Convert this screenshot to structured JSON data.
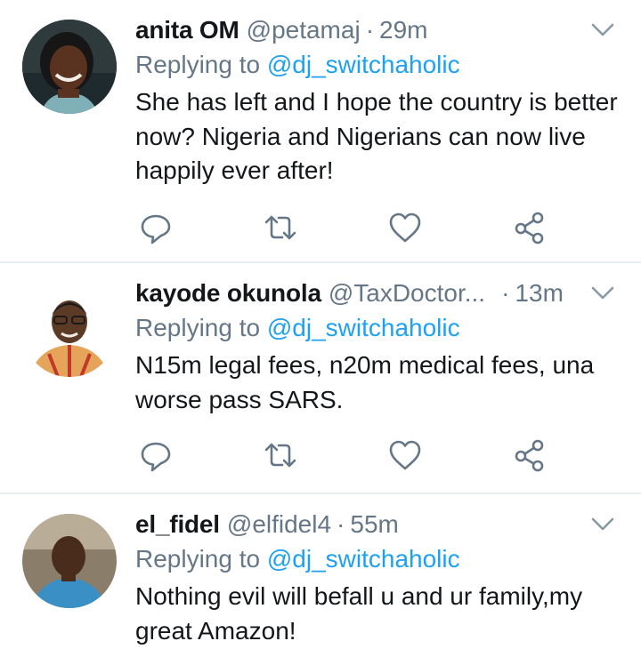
{
  "tweets": [
    {
      "name": "anita OM",
      "handle": "@petamaj",
      "separator": "·",
      "time": "29m",
      "replying_prefix": "Replying to",
      "replying_handle": "@dj_switchaholic",
      "text": "She has left and I hope the country is better now? Nigeria and Nigerians can now live happily ever after!"
    },
    {
      "name": "kayode okunola",
      "handle": "@TaxDoctor...",
      "separator": "·",
      "time": "13m",
      "replying_prefix": "Replying to",
      "replying_handle": "@dj_switchaholic",
      "text": "N15m legal fees, n20m medical fees, una worse pass SARS."
    },
    {
      "name": "el_fidel",
      "handle": "@elfidel4",
      "separator": "·",
      "time": "55m",
      "replying_prefix": "Replying to",
      "replying_handle": "@dj_switchaholic",
      "text": "Nothing evil will befall u and ur family,my great Amazon!"
    }
  ],
  "icons": {
    "reply": "reply-icon",
    "retweet": "retweet-icon",
    "like": "heart-icon",
    "share": "share-icon",
    "caret": "chevron-down-icon"
  },
  "colors": {
    "secondary_text": "#657786",
    "mention": "#1da1f2",
    "divider": "#e6ecf0"
  }
}
